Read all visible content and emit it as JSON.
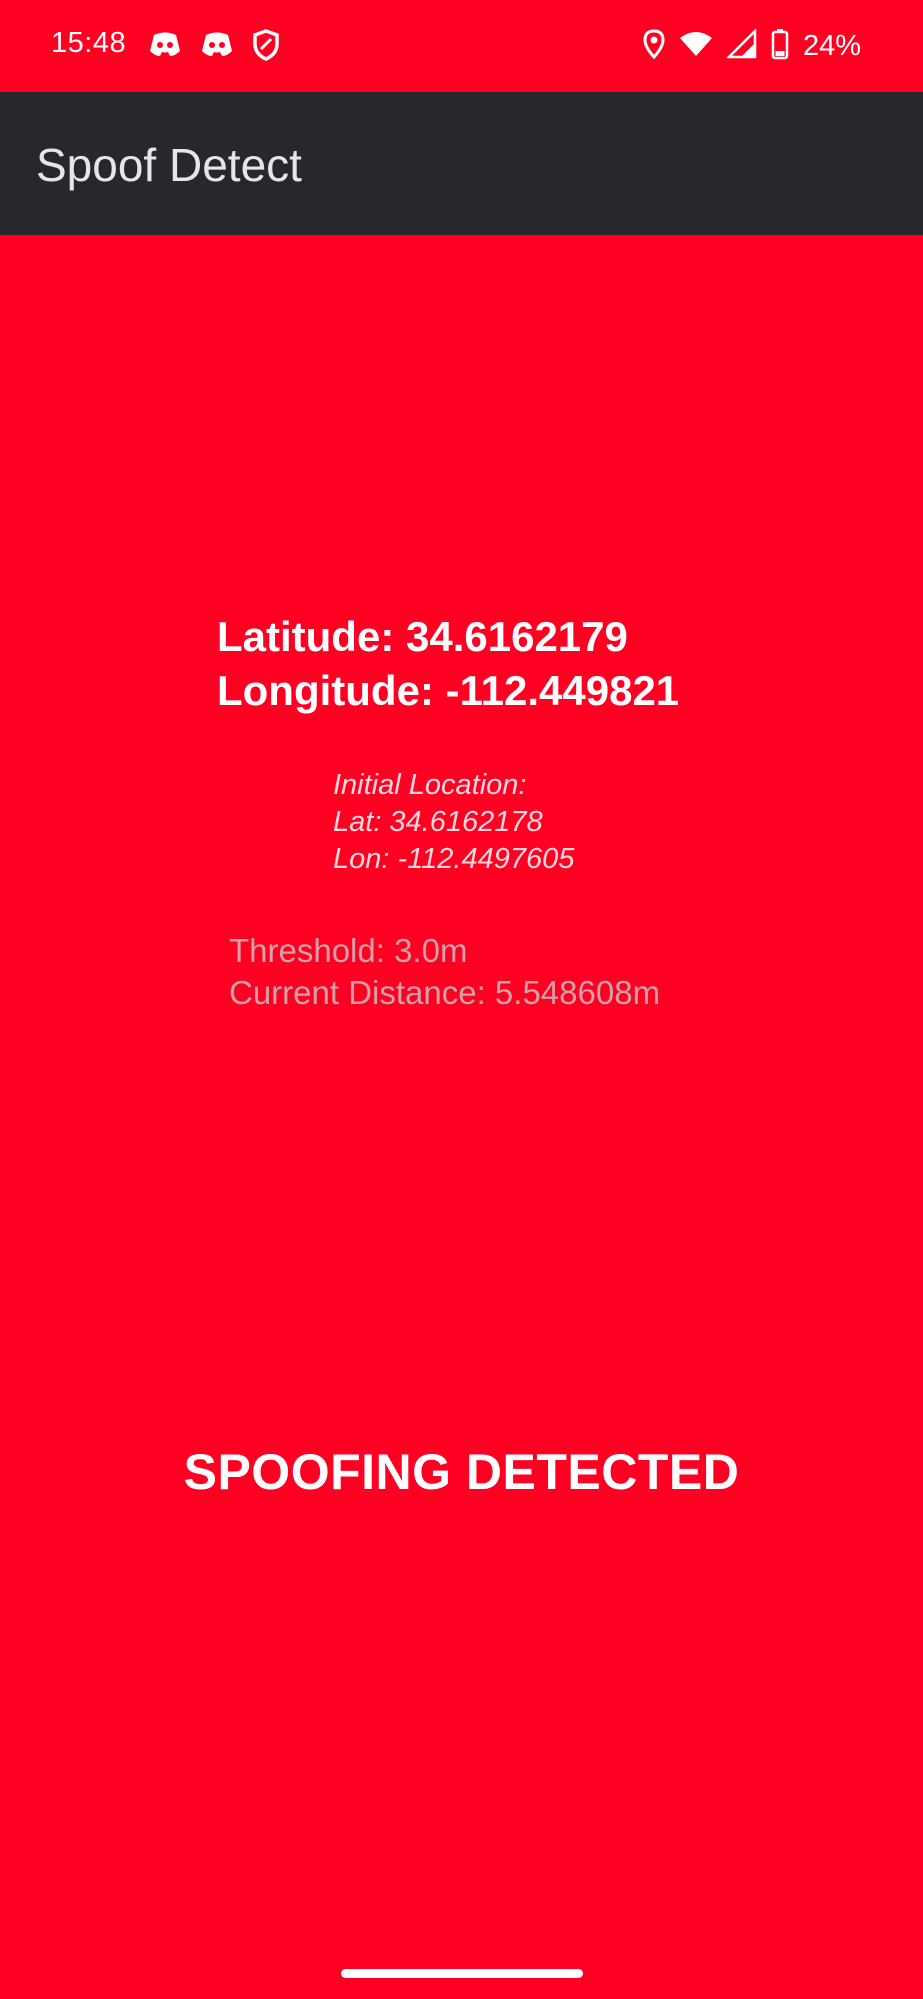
{
  "status_bar": {
    "time": "15:48",
    "battery_percent": "24%",
    "left_icons": [
      "discord-icon",
      "discord-icon",
      "shield-icon"
    ],
    "right_icons": [
      "location-icon",
      "wifi-icon",
      "signal-icon",
      "battery-icon"
    ]
  },
  "app_bar": {
    "title": "Spoof Detect"
  },
  "location": {
    "latitude_text": "Latitude: 34.6162179",
    "longitude_text": "Longitude: -112.449821"
  },
  "initial_location": {
    "heading": "Initial Location:",
    "lat_text": "Lat: 34.6162178",
    "lon_text": "Lon: -112.4497605"
  },
  "distance": {
    "threshold_text": "Threshold: 3.0m",
    "current_distance_text": "Current Distance: 5.548608m"
  },
  "verdict": {
    "text": "SPOOFING DETECTED"
  },
  "colors": {
    "background": "#ff0022",
    "app_bar": "#28272c",
    "app_title": "#e6e6e8",
    "primary_text": "#ffffff",
    "initial_text": "#ffd7dc",
    "secondary_text": "#d6a0a8"
  }
}
